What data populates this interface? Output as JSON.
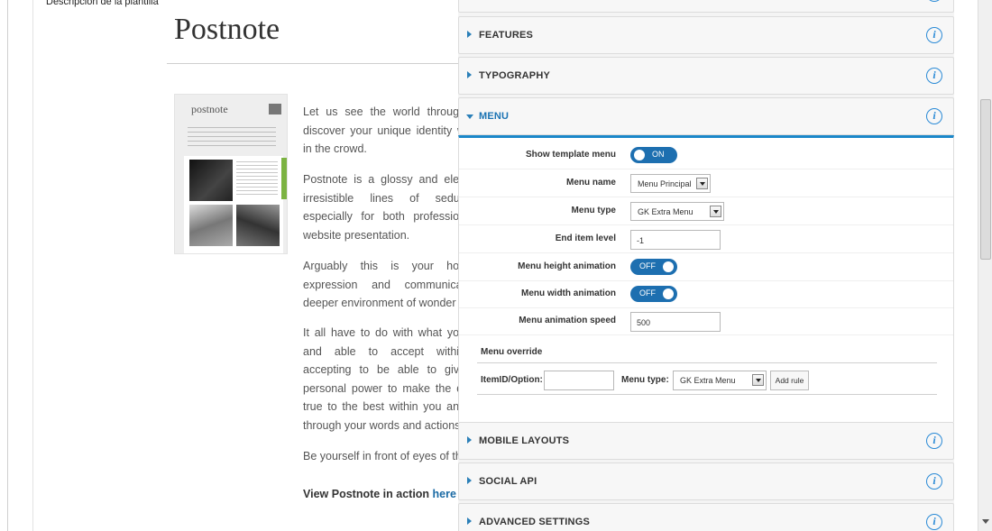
{
  "page": {
    "desc_label": "Descripción de la plantilla"
  },
  "article": {
    "title": "Postnote",
    "thumb_logo": "postnote",
    "paragraphs": [
      "Let us see the world through discover your unique identity w in the crowd.",
      "Postnote is a glossy and eleg irresistible lines of seduc especially for both profession website presentation.",
      "Arguably this is your hon expression and communicat deeper environment of wonder",
      "It all have to do with what you and able to accept within accepting to be able to give personal power to make the di true to the best within you and through your words and actions",
      "Be yourself in front of eyes of th"
    ],
    "cta_text": "View Postnote in action ",
    "cta_link": "here"
  },
  "panel": {
    "sections_top": [
      {
        "title": "FEATURES"
      },
      {
        "title": "TYPOGRAPHY"
      },
      {
        "title": "MENU"
      }
    ],
    "menu": {
      "show_template_menu": {
        "label": "Show template menu",
        "value": "ON"
      },
      "menu_name": {
        "label": "Menu name",
        "value": "Menu Principal"
      },
      "menu_type": {
        "label": "Menu type",
        "value": "GK Extra Menu"
      },
      "end_item_level": {
        "label": "End item level",
        "value": "-1"
      },
      "menu_height_animation": {
        "label": "Menu height animation",
        "value": "OFF"
      },
      "menu_width_animation": {
        "label": "Menu width animation",
        "value": "OFF"
      },
      "menu_animation_speed": {
        "label": "Menu animation speed",
        "value": "500"
      },
      "override": {
        "title": "Menu override",
        "itemid_label": "ItemID/Option:",
        "itemid_value": "",
        "type_label": "Menu type:",
        "type_value": "GK Extra Menu",
        "add_rule": "Add rule"
      }
    },
    "sections_bottom": [
      {
        "title": "MOBILE LAYOUTS"
      },
      {
        "title": "SOCIAL API"
      },
      {
        "title": "ADVANCED SETTINGS"
      }
    ]
  },
  "colors": {
    "accent": "#1b87c9",
    "toggle": "#1d6fb0",
    "info": "#2a8ad6"
  }
}
